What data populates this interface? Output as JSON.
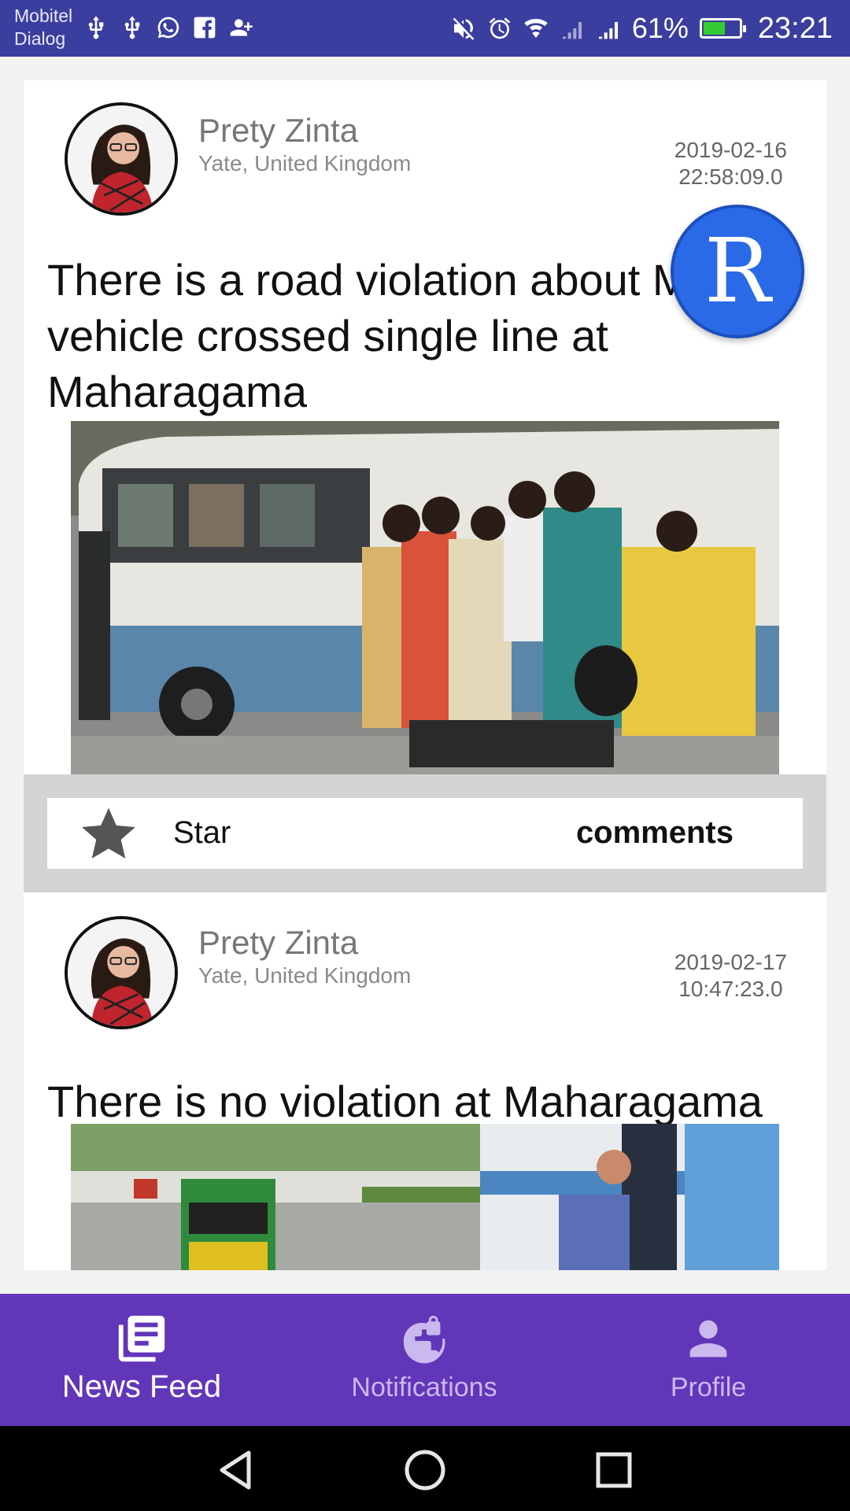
{
  "status_bar": {
    "carrier_1": "Mobitel",
    "carrier_2": "Dialog",
    "left_icons": [
      "usb-icon",
      "usb-icon",
      "whatsapp-icon",
      "facebook-icon",
      "add-contact-icon"
    ],
    "right_icons": [
      "mute-icon",
      "alarm-icon",
      "wifi-icon",
      "signal-icon",
      "signal-icon",
      "battery-icon"
    ],
    "battery_percent": "61%",
    "battery_level": 0.61,
    "time": "23:21"
  },
  "posts": [
    {
      "author": "Prety Zinta",
      "location": "Yate, United Kingdom",
      "date": "2019-02-16",
      "time": "22:58:09.0",
      "title": "There is a road violation about Motor vehicle crossed single line at Maharagama",
      "actions": {
        "star_label": "Star",
        "comments_label": "comments"
      }
    },
    {
      "author": "Prety Zinta",
      "location": "Yate, United Kingdom",
      "date": "2019-02-17",
      "time": "10:47:23.0",
      "title": "There is no violation at Maharagama"
    }
  ],
  "fab": {
    "letter": "R"
  },
  "bottom_nav": {
    "items": [
      {
        "label": "News Feed",
        "icon": "news-feed-icon",
        "active": true
      },
      {
        "label": "Notifications",
        "icon": "notifications-globe-icon",
        "active": false
      },
      {
        "label": "Profile",
        "icon": "profile-icon",
        "active": false
      }
    ]
  },
  "colors": {
    "status_bar": "#3a3e9e",
    "bottom_nav": "#6236b8",
    "fab": "#2b6ae6",
    "action_bar_bg": "#d4d4d4"
  }
}
